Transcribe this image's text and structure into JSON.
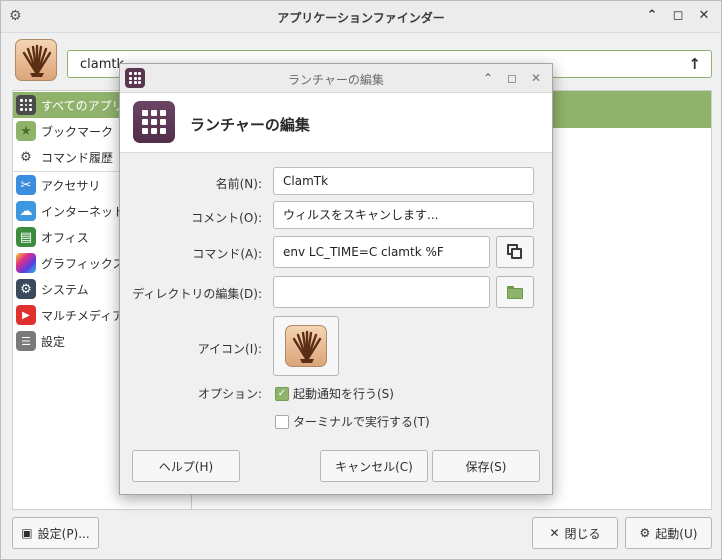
{
  "main_window": {
    "title": "アプリケーションファインダー",
    "search": {
      "value": "clamtk",
      "up_icon": "arrow-up-icon"
    },
    "categories": [
      {
        "label": "すべてのアプリケーション",
        "icon": "grid-icon",
        "color": "#4a4a4a",
        "selected": true
      },
      {
        "label": "ブックマーク",
        "icon": "star-icon",
        "color": "#8fb36b"
      },
      {
        "label": "コマンド履歴",
        "icon": "gears-icon",
        "color": "#3a3a3a"
      },
      {
        "label": "アクセサリ",
        "icon": "scissors-icon",
        "color": "#3c8de0"
      },
      {
        "label": "インターネット",
        "icon": "cloud-icon",
        "color": "#3d98e0"
      },
      {
        "label": "オフィス",
        "icon": "office-icon",
        "color": "#3d8b3d"
      },
      {
        "label": "グラフィックス",
        "icon": "palette-icon",
        "color": "#c03cc4"
      },
      {
        "label": "システム",
        "icon": "gear-icon",
        "color": "#3a4a5a"
      },
      {
        "label": "マルチメディア",
        "icon": "play-icon",
        "color": "#e03030"
      },
      {
        "label": "設定",
        "icon": "toggle-icon",
        "color": "#6a6a6a"
      }
    ],
    "buttons": {
      "settings": "設定(P)...",
      "close": "閉じる",
      "launch": "起動(U)"
    }
  },
  "dialog": {
    "title": "ランチャーの編集",
    "header_title": "ランチャーの編集",
    "fields": {
      "name": {
        "label": "名前(N):",
        "value": "ClamTk"
      },
      "comment": {
        "label": "コメント(O):",
        "value": "ウィルスをスキャンします..."
      },
      "command": {
        "label": "コマンド(A):",
        "value": "env LC_TIME=C clamtk %F"
      },
      "workdir": {
        "label": "ディレクトリの編集(D):",
        "value": ""
      },
      "icon": {
        "label": "アイコン(I):"
      }
    },
    "options": {
      "label": "オプション:",
      "startup_notify": {
        "label": "起動通知を行う(S)",
        "checked": true
      },
      "run_in_terminal": {
        "label": "ターミナルで実行する(T)",
        "checked": false
      }
    },
    "buttons": {
      "help": "ヘルプ(H)",
      "cancel": "キャンセル(C)",
      "save": "保存(S)"
    }
  }
}
